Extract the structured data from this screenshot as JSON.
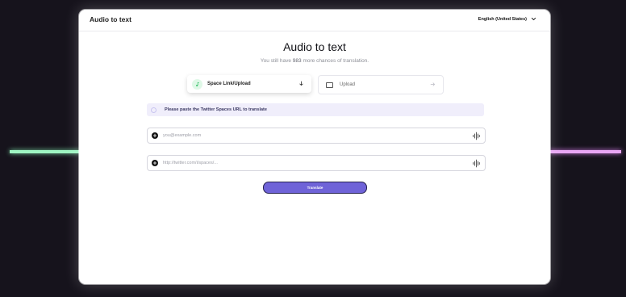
{
  "app": {
    "title": "Audio to text",
    "language": "English (United States)"
  },
  "main": {
    "heading": "Audio to text",
    "subtitle_prefix": "You still have",
    "remaining_count": "983",
    "subtitle_suffix": "more chances of translation."
  },
  "tabs": [
    {
      "label": "Space Link/Upload",
      "icon": "music-note-icon",
      "action_icon": "arrow-down-icon"
    },
    {
      "label": "Upload",
      "icon": "upload-box-icon",
      "action_icon": "arrow-right-icon"
    }
  ],
  "info": {
    "message": "Please paste the Twitter Spaces URL to translate"
  },
  "inputs": [
    {
      "placeholder": "you@example.com",
      "value": ""
    },
    {
      "placeholder": "http://twitter.com/i/spaces/...",
      "value": ""
    }
  ],
  "actions": {
    "translate_label": "Translate"
  },
  "colors": {
    "accent": "#6f63d8",
    "glow_left": "#9ef5c2",
    "glow_right": "#e9a6f4",
    "background": "#16131c"
  }
}
